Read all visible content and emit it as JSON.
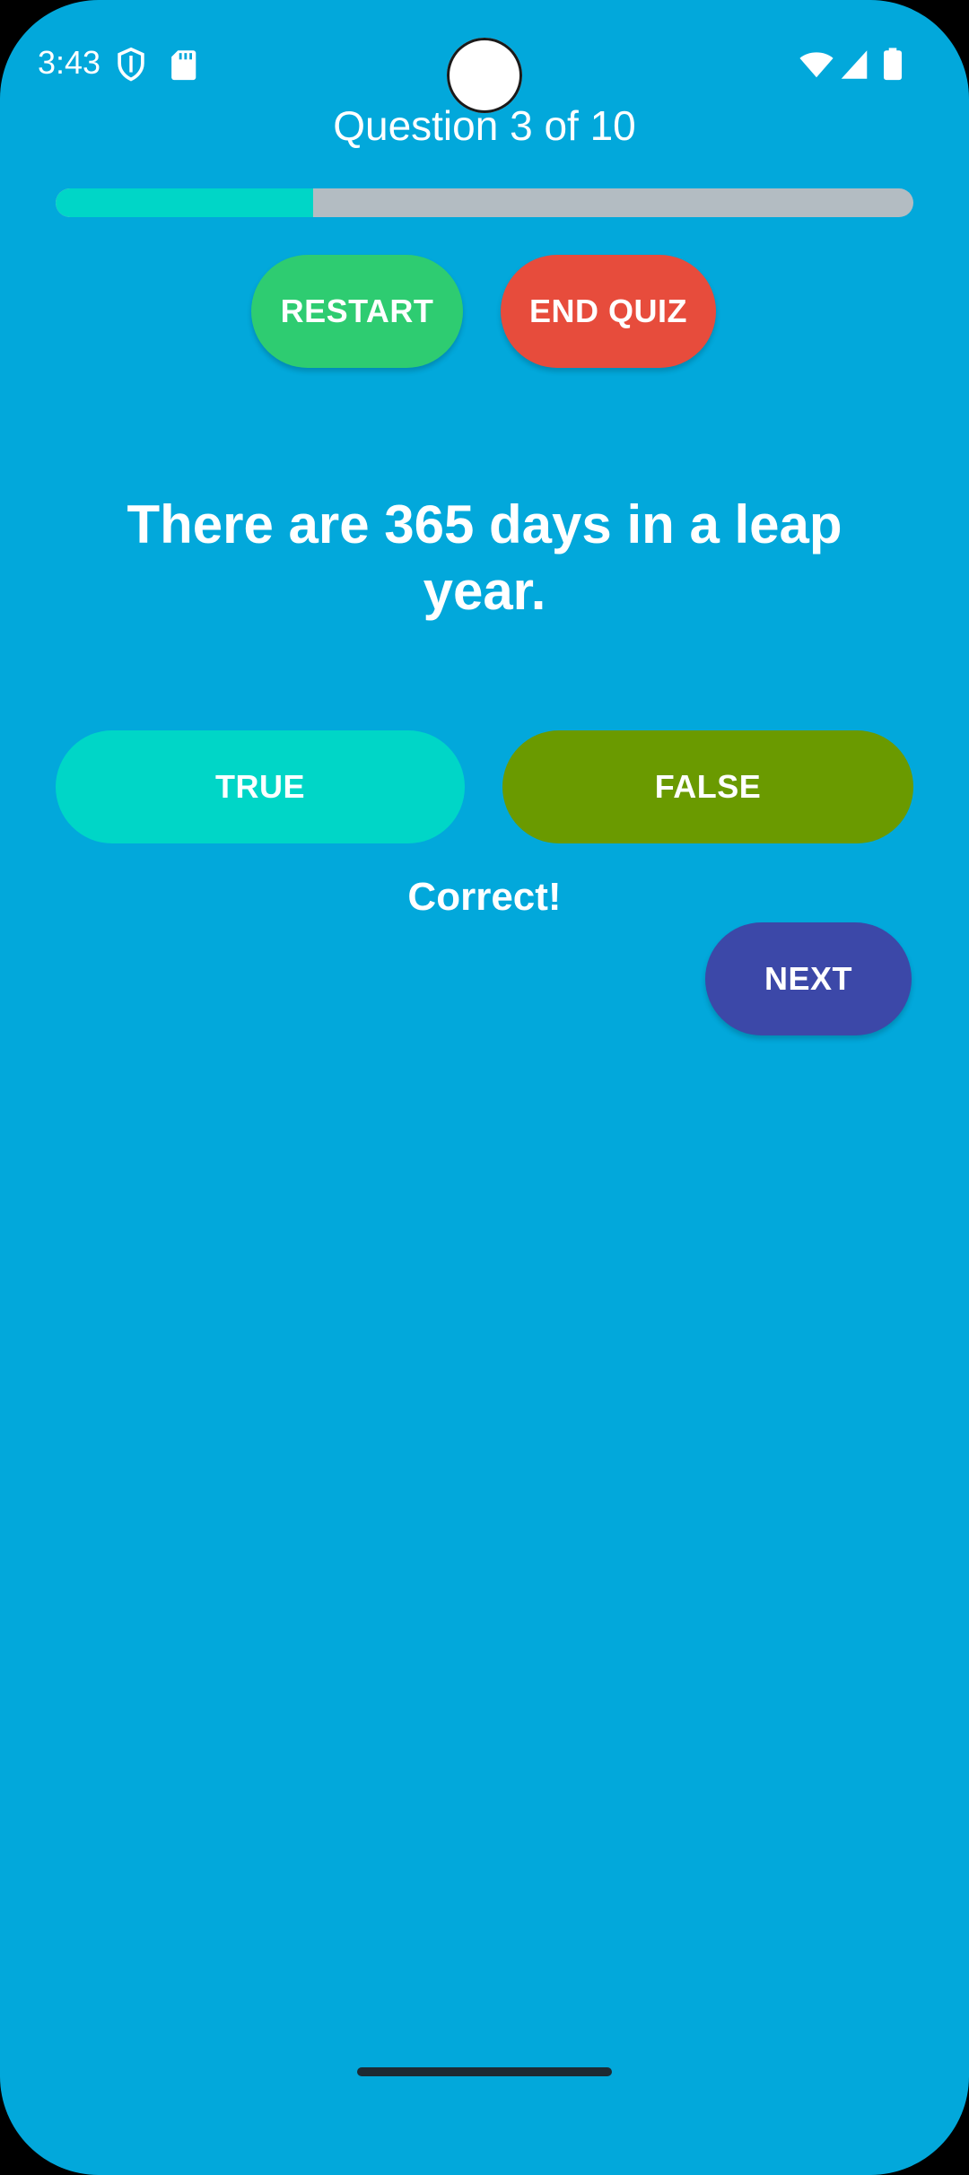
{
  "status_bar": {
    "time": "3:43",
    "icons_left": [
      "shield-icon",
      "sd-card-icon"
    ],
    "icons_right": [
      "wifi-icon",
      "signal-icon",
      "battery-icon"
    ]
  },
  "quiz": {
    "counter": "Question 3 of 10",
    "progress_fraction": 0.3,
    "restart_label": "RESTART",
    "end_quiz_label": "END QUIZ",
    "question": "There are 365 days in a leap year.",
    "true_label": "TRUE",
    "false_label": "FALSE",
    "feedback": "Correct!",
    "next_label": "NEXT"
  },
  "colors": {
    "background": "#02A8DB",
    "progress_fill": "#00D6C7",
    "progress_track": "#B3BCC2",
    "restart": "#2ECC71",
    "end_quiz": "#E74C3C",
    "true": "#00D6C7",
    "false": "#6A9A00",
    "next": "#3C48A8"
  }
}
